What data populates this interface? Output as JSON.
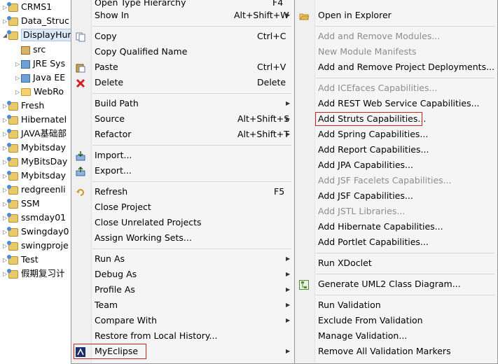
{
  "tree": {
    "items": [
      {
        "label": "CRMS1",
        "icon": "project-icon",
        "arrow": "▷"
      },
      {
        "label": "Data_Struc",
        "icon": "project-icon",
        "arrow": "▷"
      },
      {
        "label": "DisplayHur",
        "icon": "project-icon",
        "arrow": "◢",
        "selected": true
      },
      {
        "label": "src",
        "icon": "package-folder-icon",
        "arrow": ""
      },
      {
        "label": "JRE Sys",
        "icon": "library-icon",
        "arrow": "▷"
      },
      {
        "label": "Java EE",
        "icon": "library-icon",
        "arrow": "▷"
      },
      {
        "label": "WebRo",
        "icon": "folder-icon",
        "arrow": "▷"
      },
      {
        "label": "Fresh",
        "icon": "project-icon",
        "arrow": "▷"
      },
      {
        "label": "Hibernatel",
        "icon": "project-icon",
        "arrow": "▷"
      },
      {
        "label": "JAVA基础部",
        "icon": "project-icon",
        "arrow": "▷"
      },
      {
        "label": "Mybitsday",
        "icon": "project-icon",
        "arrow": "▷"
      },
      {
        "label": "MyBitsDay",
        "icon": "project-icon",
        "arrow": "▷"
      },
      {
        "label": "Mybitsday",
        "icon": "project-icon",
        "arrow": "▷"
      },
      {
        "label": "redgreenli",
        "icon": "project-icon",
        "arrow": "▷"
      },
      {
        "label": "SSM",
        "icon": "project-icon",
        "arrow": "▷"
      },
      {
        "label": "ssmday01",
        "icon": "project-icon",
        "arrow": "▷"
      },
      {
        "label": "Swingday0",
        "icon": "project-icon",
        "arrow": "▷"
      },
      {
        "label": "swingproje",
        "icon": "project-icon",
        "arrow": "▷"
      },
      {
        "label": "Test",
        "icon": "project-icon",
        "arrow": "▷"
      },
      {
        "label": "假期复习计",
        "icon": "project-icon",
        "arrow": "▷"
      }
    ]
  },
  "context_menu": {
    "partial_top_label": "Open Type Hierarchy",
    "partial_top_shortcut": "F4",
    "items": [
      {
        "label": "Show In",
        "shortcut": "Alt+Shift+W",
        "submenu": true
      },
      {
        "label": "Copy",
        "shortcut": "Ctrl+C",
        "icon": "copy-icon"
      },
      {
        "label": "Copy Qualified Name",
        "shortcut": ""
      },
      {
        "label": "Paste",
        "shortcut": "Ctrl+V",
        "icon": "paste-icon"
      },
      {
        "label": "Delete",
        "shortcut": "Delete",
        "icon": "delete-icon"
      },
      {
        "label": "Build Path",
        "shortcut": "",
        "submenu": true
      },
      {
        "label": "Source",
        "shortcut": "Alt+Shift+S",
        "submenu": true
      },
      {
        "label": "Refactor",
        "shortcut": "Alt+Shift+T",
        "submenu": true
      },
      {
        "label": "Import...",
        "shortcut": "",
        "icon": "import-icon"
      },
      {
        "label": "Export...",
        "shortcut": "",
        "icon": "export-icon"
      },
      {
        "label": "Refresh",
        "shortcut": "F5",
        "icon": "refresh-icon"
      },
      {
        "label": "Close Project",
        "shortcut": ""
      },
      {
        "label": "Close Unrelated Projects",
        "shortcut": ""
      },
      {
        "label": "Assign Working Sets...",
        "shortcut": ""
      },
      {
        "label": "Run As",
        "shortcut": "",
        "submenu": true
      },
      {
        "label": "Debug As",
        "shortcut": "",
        "submenu": true
      },
      {
        "label": "Profile As",
        "shortcut": "",
        "submenu": true
      },
      {
        "label": "Team",
        "shortcut": "",
        "submenu": true
      },
      {
        "label": "Compare With",
        "shortcut": "",
        "submenu": true
      },
      {
        "label": "Restore from Local History...",
        "shortcut": ""
      },
      {
        "label": "MyEclipse",
        "shortcut": "",
        "submenu": true,
        "icon": "myeclipse-icon"
      }
    ]
  },
  "submenu": {
    "items": [
      {
        "label": "Open in Explorer",
        "enabled": true,
        "icon": "open-folder-icon"
      },
      {
        "label": "Add and Remove Modules...",
        "enabled": false
      },
      {
        "label": "New Module Manifests",
        "enabled": false
      },
      {
        "label": "Add and Remove Project Deployments...",
        "enabled": true
      },
      {
        "label": "Add ICEfaces Capabilities...",
        "enabled": false
      },
      {
        "label": "Add REST Web Service Capabilities...",
        "enabled": true
      },
      {
        "label": "Add Struts Capabilities...",
        "enabled": true
      },
      {
        "label": "Add Spring Capabilities...",
        "enabled": true
      },
      {
        "label": "Add Report Capabilities...",
        "enabled": true
      },
      {
        "label": "Add JPA Capabilities...",
        "enabled": true
      },
      {
        "label": "Add JSF Facelets Capabilities...",
        "enabled": false
      },
      {
        "label": "Add JSF Capabilities...",
        "enabled": true
      },
      {
        "label": "Add JSTL Libraries...",
        "enabled": false
      },
      {
        "label": "Add Hibernate Capabilities...",
        "enabled": true
      },
      {
        "label": "Add Portlet Capabilities...",
        "enabled": true
      },
      {
        "label": "Run XDoclet",
        "enabled": true
      },
      {
        "label": "Generate UML2 Class Diagram...",
        "enabled": true,
        "icon": "uml-icon"
      },
      {
        "label": "Run Validation",
        "enabled": true
      },
      {
        "label": "Exclude From Validation",
        "enabled": true
      },
      {
        "label": "Manage Validation...",
        "enabled": true
      },
      {
        "label": "Remove All Validation Markers",
        "enabled": true
      }
    ]
  },
  "colors": {
    "highlight_border": "#cc2222",
    "selection_bg": "#dbe9f9",
    "disabled_text": "#8d8d8d"
  }
}
